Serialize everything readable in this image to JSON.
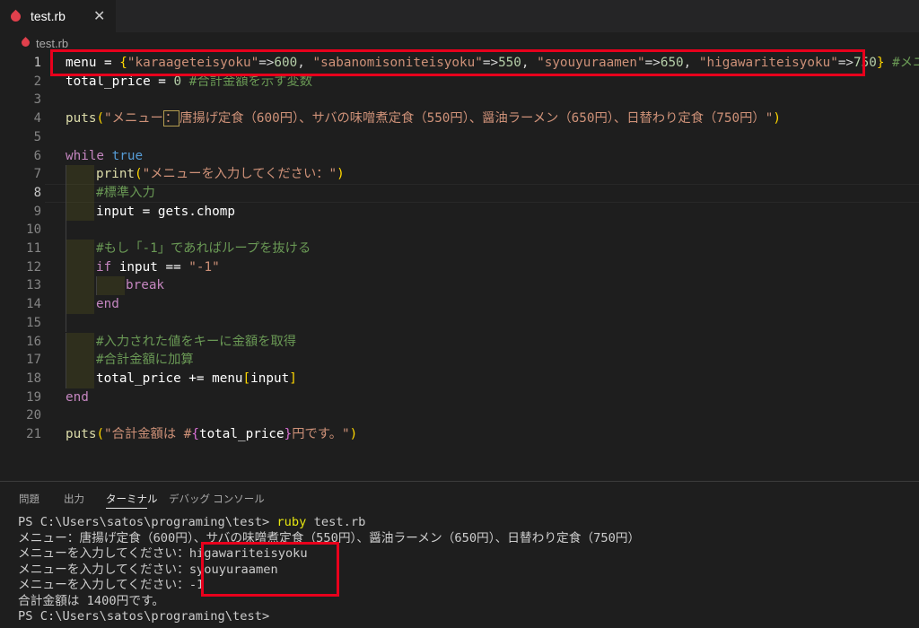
{
  "tab": {
    "filename": "test.rb",
    "close": "✕"
  },
  "breadcrumb": {
    "filename": "test.rb"
  },
  "editor": {
    "line_numbers": [
      "1",
      "2",
      "3",
      "4",
      "5",
      "6",
      "7",
      "8",
      "9",
      "10",
      "11",
      "12",
      "13",
      "14",
      "15",
      "16",
      "17",
      "18",
      "19",
      "20",
      "21"
    ],
    "l1": {
      "a": "menu = ",
      "b": "{",
      "c": "\"karaageteisyoku\"",
      "d": "=>",
      "e": "600",
      "f": ", ",
      "g": "\"sabanomisoniteisyoku\"",
      "h": "=>",
      "i": "550",
      "j": ", ",
      "k": "\"syouyuraamen\"",
      "l": "=>",
      "m": "650",
      "n": ", ",
      "o": "\"higawariteisyoku\"",
      "p": "=>",
      "q": "750",
      "r": "}",
      "s": " #メニュー"
    },
    "l2": {
      "a": "total_price = ",
      "b": "0",
      "c": " #合計金額を示す変数"
    },
    "l4": {
      "a": "puts",
      "b": "(",
      "c": "\"メニュー",
      "d": "：",
      "e": "唐揚げ定食（600円）、サバの味噌煮定食（550円）、醤油ラーメン（650円）、日替わり定食（750円）\"",
      "f": ")"
    },
    "l6": {
      "a": "while",
      "b": " true"
    },
    "l7": {
      "a": "print",
      "b": "(",
      "c": "\"メニューを入力してください：\"",
      "d": ")"
    },
    "l8": {
      "a": "#標準入力"
    },
    "l9": {
      "a": "input = gets.chomp"
    },
    "l11": {
      "a": "#もし「-1」であればループを抜ける"
    },
    "l12": {
      "a": "if",
      "b": " input == ",
      "c": "\"-1\""
    },
    "l13": {
      "a": "break"
    },
    "l14": {
      "a": "end"
    },
    "l16": {
      "a": "#入力された値をキーに金額を取得"
    },
    "l17": {
      "a": "#合計金額に加算"
    },
    "l18": {
      "a": "total_price += menu",
      "b": "[",
      "c": "input",
      "d": "]"
    },
    "l19": {
      "a": "end"
    },
    "l21": {
      "a": "puts",
      "b": "(",
      "c": "\"合計金額は #",
      "d": "{",
      "e": "total_price",
      "f": "}",
      "g": "円です。\"",
      "h": ")"
    }
  },
  "panel": {
    "tabs": [
      "問題",
      "出力",
      "ターミナル",
      "デバッグ コンソール"
    ],
    "terminal": {
      "l1_prompt": "PS C:\\Users\\satos\\programing\\test> ",
      "l1_cmd": "ruby",
      "l1_arg": " test.rb",
      "l2": "メニュー：唐揚げ定食（600円）、サバの味噌煮定食（550円）、醤油ラーメン（650円）、日替わり定食（750円）",
      "l3_prompt": "メニューを入力してください：",
      "l3_input": "higawariteisyoku",
      "l4_prompt": "メニューを入力してください：",
      "l4_input": "syouyuraamen",
      "l5_prompt": "メニューを入力してください：",
      "l5_input": "-1",
      "l6": "合計金額は 1400円です。",
      "l7": "PS C:\\Users\\satos\\programing\\test>"
    }
  },
  "colors": {
    "highlight": "#e8001c",
    "background": "#1e1e1e",
    "ruby_icon": "#e0404c"
  }
}
